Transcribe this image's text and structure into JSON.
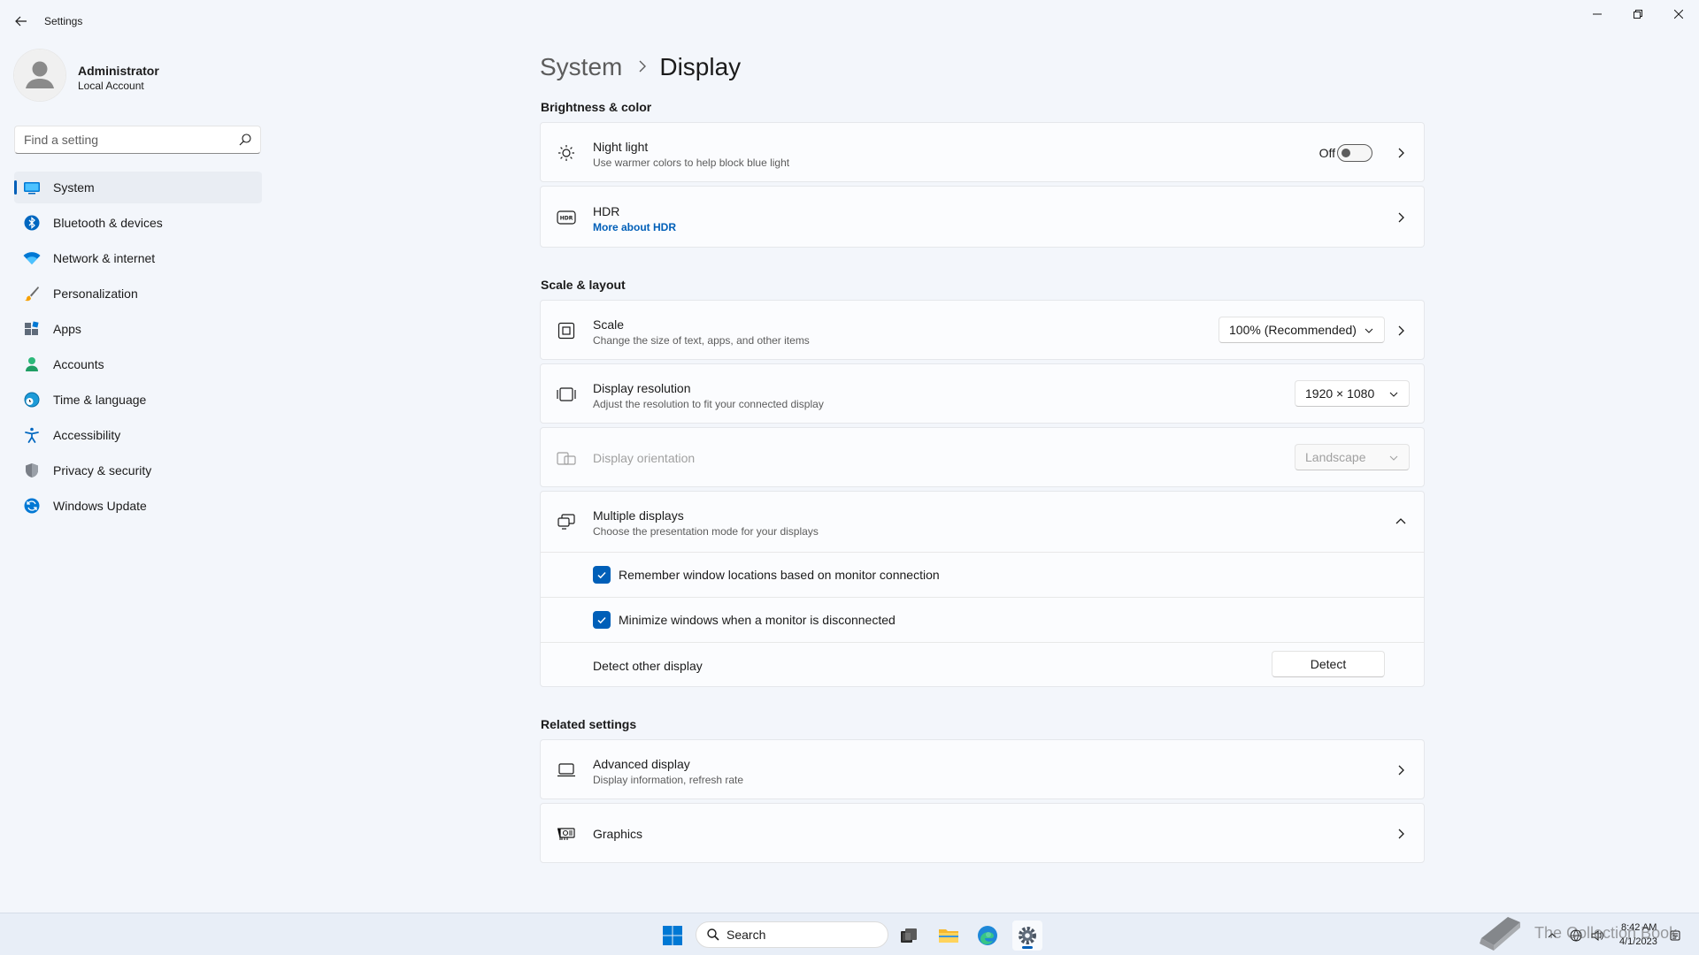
{
  "window": {
    "title": "Settings"
  },
  "profile": {
    "name": "Administrator",
    "account_type": "Local Account"
  },
  "search": {
    "placeholder": "Find a setting"
  },
  "sidebar": {
    "items": [
      {
        "label": "System",
        "icon": "monitor-icon",
        "selected": true
      },
      {
        "label": "Bluetooth & devices",
        "icon": "bluetooth-icon"
      },
      {
        "label": "Network & internet",
        "icon": "wifi-icon"
      },
      {
        "label": "Personalization",
        "icon": "brush-icon"
      },
      {
        "label": "Apps",
        "icon": "apps-icon"
      },
      {
        "label": "Accounts",
        "icon": "person-icon"
      },
      {
        "label": "Time & language",
        "icon": "globe-clock-icon"
      },
      {
        "label": "Accessibility",
        "icon": "accessibility-icon"
      },
      {
        "label": "Privacy & security",
        "icon": "shield-icon"
      },
      {
        "label": "Windows Update",
        "icon": "update-icon"
      }
    ]
  },
  "breadcrumb": {
    "parent": "System",
    "separator": "›",
    "current": "Display"
  },
  "brightness": {
    "section_title": "Brightness & color",
    "night_light": {
      "title": "Night light",
      "subtitle": "Use warmer colors to help block blue light",
      "state_label": "Off",
      "enabled": false
    },
    "hdr": {
      "title": "HDR",
      "link": "More about HDR"
    }
  },
  "scale_layout": {
    "section_title": "Scale & layout",
    "scale": {
      "title": "Scale",
      "subtitle": "Change the size of text, apps, and other items",
      "value": "100% (Recommended)"
    },
    "resolution": {
      "title": "Display resolution",
      "subtitle": "Adjust the resolution to fit your connected display",
      "value": "1920 × 1080"
    },
    "orientation": {
      "title": "Display orientation",
      "value": "Landscape",
      "disabled": true
    },
    "multiple_displays": {
      "title": "Multiple displays",
      "subtitle": "Choose the presentation mode for your displays",
      "expanded": true,
      "remember_label": "Remember window locations based on monitor connection",
      "remember_checked": true,
      "minimize_label": "Minimize windows when a monitor is disconnected",
      "minimize_checked": true,
      "detect_label": "Detect other display",
      "detect_button": "Detect"
    }
  },
  "related": {
    "section_title": "Related settings",
    "advanced_display": {
      "title": "Advanced display",
      "subtitle": "Display information, refresh rate"
    },
    "graphics": {
      "title": "Graphics"
    }
  },
  "taskbar": {
    "search_label": "Search",
    "time": "8:42 AM",
    "date": "4/1/2023",
    "watermark_text": "The Collection Book"
  },
  "colors": {
    "accent": "#005fb8",
    "background": "#f3f6fb",
    "card": "#fbfcfe"
  }
}
